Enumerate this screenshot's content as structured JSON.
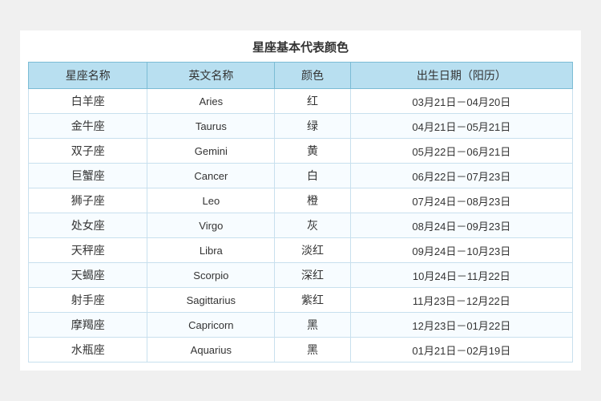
{
  "title": "星座基本代表颜色",
  "columns": [
    "星座名称",
    "英文名称",
    "颜色",
    "出生日期（阳历）"
  ],
  "rows": [
    {
      "chinese": "白羊座",
      "english": "Aries",
      "color": "红",
      "dates": "03月21日－04月20日"
    },
    {
      "chinese": "金牛座",
      "english": "Taurus",
      "color": "绿",
      "dates": "04月21日－05月21日"
    },
    {
      "chinese": "双子座",
      "english": "Gemini",
      "color": "黄",
      "dates": "05月22日－06月21日"
    },
    {
      "chinese": "巨蟹座",
      "english": "Cancer",
      "color": "白",
      "dates": "06月22日－07月23日"
    },
    {
      "chinese": "狮子座",
      "english": "Leo",
      "color": "橙",
      "dates": "07月24日－08月23日"
    },
    {
      "chinese": "处女座",
      "english": "Virgo",
      "color": "灰",
      "dates": "08月24日－09月23日"
    },
    {
      "chinese": "天秤座",
      "english": "Libra",
      "color": "淡红",
      "dates": "09月24日－10月23日"
    },
    {
      "chinese": "天蝎座",
      "english": "Scorpio",
      "color": "深红",
      "dates": "10月24日－11月22日"
    },
    {
      "chinese": "射手座",
      "english": "Sagittarius",
      "color": "紫红",
      "dates": "11月23日－12月22日"
    },
    {
      "chinese": "摩羯座",
      "english": "Capricorn",
      "color": "黑",
      "dates": "12月23日－01月22日"
    },
    {
      "chinese": "水瓶座",
      "english": "Aquarius",
      "color": "黑",
      "dates": "01月21日－02月19日"
    }
  ]
}
